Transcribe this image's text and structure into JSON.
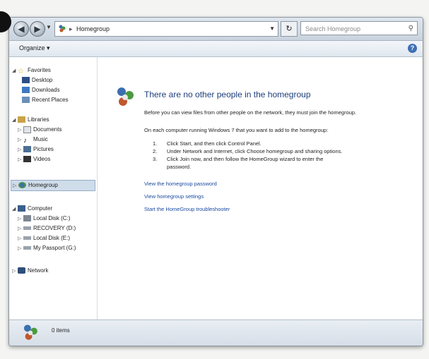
{
  "address_bar": {
    "path": [
      "Homegroup"
    ],
    "search_placeholder": "Search Homegroup"
  },
  "toolbar": {
    "organize_label": "Organize ▾",
    "help_label": "?"
  },
  "sidebar": {
    "favorites": {
      "label": "Favorites",
      "items": [
        "Desktop",
        "Downloads",
        "Recent Places"
      ]
    },
    "libraries": {
      "label": "Libraries",
      "items": [
        "Documents",
        "Music",
        "Pictures",
        "Videos"
      ]
    },
    "homegroup": {
      "label": "Homegroup"
    },
    "computer": {
      "label": "Computer",
      "items": [
        "Local Disk (C:)",
        "RECOVERY (D:)",
        "Local Disk (E:)",
        "My Passport (G:)"
      ]
    },
    "network": {
      "label": "Network"
    }
  },
  "content": {
    "title": "There are no other people in the homegroup",
    "intro": "Before you can view files from other people on the network, they must join the homegroup.",
    "instruction": "On each computer running Windows 7 that you want to add to the homegroup:",
    "steps": [
      {
        "n": "1.",
        "text": "Click Start, and then click Control Panel."
      },
      {
        "n": "2.",
        "text": "Under Network and Internet, click Choose homegroup and sharing options."
      },
      {
        "n": "3.",
        "text": "Click Join now, and then follow the HomeGroup wizard to enter the"
      },
      {
        "n": "",
        "text": "password."
      }
    ],
    "links": [
      "View the homegroup password",
      "View homegroup settings",
      "Start the HomeGroup troubleshooter"
    ]
  },
  "details": {
    "items": "0 items"
  },
  "colors": {
    "accent": "#1d3d7a",
    "link": "#1a4aa0",
    "selection": "#cfdcea"
  }
}
